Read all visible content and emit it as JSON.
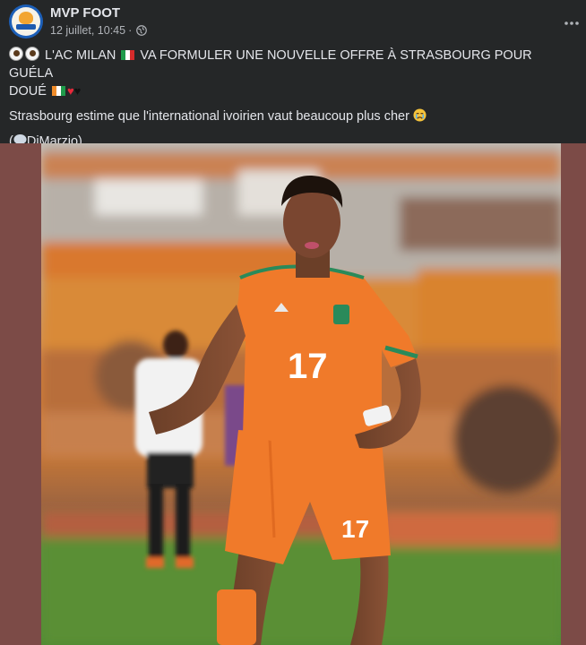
{
  "post": {
    "page_name": "MVP FOOT",
    "timestamp": "12 juillet, 10:45",
    "separator": "·",
    "headline_main": "L'AC MILAN",
    "headline_rest": "VA FORMULER UNE NOUVELLE OFFRE À STRASBOURG POUR GUÉLA",
    "headline_line2": "DOUÉ",
    "body": "Strasbourg estime que l'international ivoirien vaut beaucoup plus cher",
    "source_open": "(",
    "source": "DiMarzio)",
    "more_icon": "ellipsis-icon",
    "avatar_icon": "mvp-foot-logo"
  },
  "photo": {
    "jersey_number": "17",
    "shorts_number": "17"
  },
  "colors": {
    "background": "#252728",
    "photo_border": "#7c4b47",
    "jersey": "#f07a2a",
    "text": "#e4e6eb",
    "meta": "#b0b3b8"
  }
}
